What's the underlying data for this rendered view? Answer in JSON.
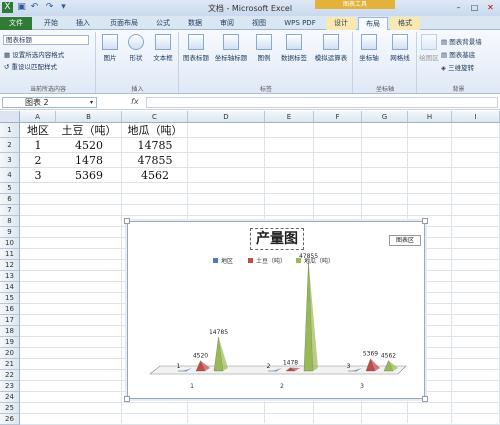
{
  "window": {
    "title": "文档 - Microsoft Excel",
    "context_label": "图表工具"
  },
  "tabs": [
    "文件",
    "开始",
    "插入",
    "页面布局",
    "公式",
    "数据",
    "审阅",
    "视图",
    "WPS PDF",
    "设计",
    "布局",
    "格式"
  ],
  "ribbon": {
    "selection": {
      "dropdown": "图表标题",
      "items": [
        "设置所选内容格式",
        "重设以匹配样式"
      ],
      "label": "当前所选内容"
    },
    "insert": {
      "items": [
        "图片",
        "形状",
        "文本框"
      ],
      "label": "插入"
    },
    "labels": {
      "items": [
        "图表标题",
        "坐标轴标题",
        "图例",
        "数据标签",
        "模拟运算表"
      ],
      "label": "标签"
    },
    "axes": {
      "items": [
        "坐标轴",
        "网格线"
      ],
      "label": "坐标轴"
    },
    "background": {
      "plot_area": "绘图区",
      "items": [
        "图表背景墙",
        "图表基底",
        "三维旋转"
      ],
      "label": "背景"
    }
  },
  "formula_bar": {
    "name_box": "图表 2",
    "fx": "fx"
  },
  "columns": [
    "A",
    "B",
    "C",
    "D",
    "E",
    "F",
    "G",
    "H",
    "I"
  ],
  "rows": [
    "1",
    "2",
    "3",
    "4",
    "5",
    "6",
    "7",
    "8",
    "9",
    "10",
    "11",
    "12",
    "13",
    "14",
    "15",
    "16",
    "17",
    "18",
    "19",
    "20",
    "21",
    "22",
    "23",
    "24",
    "25",
    "26"
  ],
  "cells": [
    [
      "地区",
      "土豆（吨）",
      "地瓜（吨）"
    ],
    [
      "1",
      "4520",
      "14785"
    ],
    [
      "2",
      "1478",
      "47855"
    ],
    [
      "3",
      "5369",
      "4562"
    ]
  ],
  "chart_data": {
    "type": "bar",
    "title": "产量图",
    "tooltip": "图表区",
    "categories": [
      "1",
      "2",
      "3"
    ],
    "series": [
      {
        "name": "地区",
        "values": [
          1,
          2,
          3
        ],
        "color": "#4a7ebb"
      },
      {
        "name": "土豆（吨）",
        "values": [
          4520,
          1478,
          5369
        ],
        "color": "#be4b48"
      },
      {
        "name": "地瓜（吨）",
        "values": [
          14785,
          47855,
          4562
        ],
        "color": "#98b954"
      }
    ],
    "ylim": [
      0,
      47855
    ],
    "legend": "top"
  }
}
